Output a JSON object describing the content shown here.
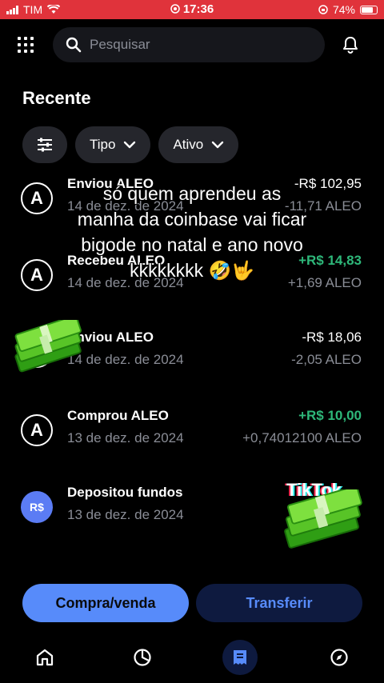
{
  "status_bar": {
    "carrier": "TIM",
    "time": "17:36",
    "battery": "74%"
  },
  "search": {
    "placeholder": "Pesquisar"
  },
  "section_title": "Recente",
  "filters": {
    "type_label": "Tipo",
    "asset_label": "Ativo"
  },
  "transactions": [
    {
      "icon": "A",
      "title": "Enviou ALEO",
      "date": "14 de dez. de 2024",
      "amount_fiat": "-R$ 102,95",
      "amount_crypto": "-11,71 ALEO",
      "positive": false
    },
    {
      "icon": "A",
      "title": "Recebeu ALEO",
      "date": "14 de dez. de 2024",
      "amount_fiat": "+R$ 14,83",
      "amount_crypto": "+1,69 ALEO",
      "positive": true
    },
    {
      "icon": "A",
      "title": "Enviou ALEO",
      "date": "14 de dez. de 2024",
      "amount_fiat": "-R$ 18,06",
      "amount_crypto": "-2,05 ALEO",
      "positive": false
    },
    {
      "icon": "A",
      "title": "Comprou ALEO",
      "date": "13 de dez. de 2024",
      "amount_fiat": "+R$ 10,00",
      "amount_crypto": "+0,74012100 ALEO",
      "positive": true
    },
    {
      "icon": "R$",
      "title": "Depositou fundos",
      "date": "13 de dez. de 2024",
      "amount_fiat": "",
      "amount_crypto": "",
      "positive": false
    }
  ],
  "caption": {
    "line1": "só quem aprendeu as",
    "line2": "manha da coinbase vai ficar",
    "line3": "bigode no natal e ano novo",
    "line4": "kkkkkkkk 🤣🤟"
  },
  "watermark": "TikTok",
  "actions": {
    "buy_sell": "Compra/venda",
    "transfer": "Transferir"
  },
  "colors": {
    "positive": "#2eb87a",
    "brand_blue": "#578bfa",
    "status_bar": "#e0333b"
  }
}
